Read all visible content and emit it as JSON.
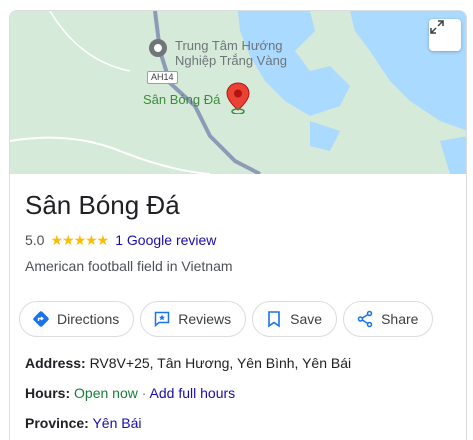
{
  "map": {
    "poi_1": {
      "line1": "Trung Tâm Hướng",
      "line2": "Nghiệp Trắng Vàng"
    },
    "road_badge": "AH14",
    "place_label": "Sân Bóng Đá",
    "colors": {
      "land": "#d5ead8",
      "water": "#aadaff",
      "road": "#8d9cb6",
      "pin": "#ea4335"
    }
  },
  "place": {
    "name": "Sân Bóng Đá",
    "rating": "5.0",
    "stars": "★★★★★",
    "review_text": "1 Google review",
    "category": "American football field in Vietnam"
  },
  "actions": [
    {
      "label": "Directions",
      "icon": "directions-icon"
    },
    {
      "label": "Reviews",
      "icon": "reviews-icon"
    },
    {
      "label": "Save",
      "icon": "bookmark-icon"
    },
    {
      "label": "Share",
      "icon": "share-icon"
    }
  ],
  "details": {
    "address_label": "Address:",
    "address_value": "RV8V+25, Tân Hương, Yên Bình, Yên Bái",
    "hours_label": "Hours:",
    "hours_status": "Open now",
    "hours_sep": "·",
    "hours_link": "Add full hours",
    "province_label": "Province:",
    "province_value": "Yên Bái"
  }
}
